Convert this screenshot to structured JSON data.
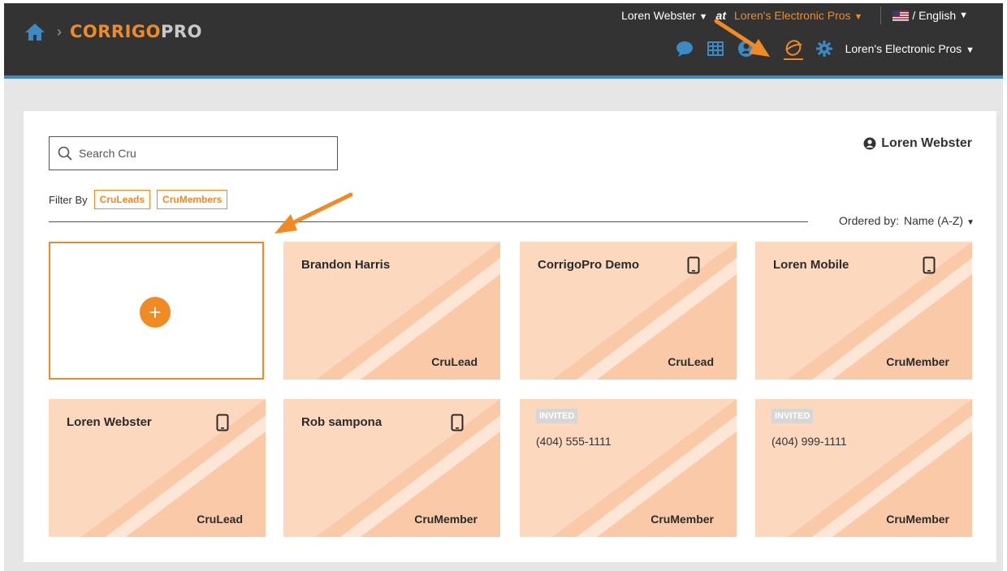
{
  "header": {
    "logo_part1": "CORRIGO",
    "logo_part2": "PRO",
    "crumb_sep": "›",
    "user_name": "Loren Webster",
    "at_label": "at",
    "org_name": "Loren's Electronic Pros",
    "language": "/ English",
    "org_select": "Loren's Electronic Pros",
    "caret": "▼"
  },
  "toolbar_icons": [
    "chat-icon",
    "table-icon",
    "profile-icon",
    "cru-icon",
    "settings-icon"
  ],
  "search": {
    "placeholder": "Search Cru"
  },
  "current_user": "Loren Webster",
  "filter": {
    "label": "Filter By",
    "chips": [
      "CruLeads",
      "CruMembers"
    ]
  },
  "order": {
    "label": "Ordered by:",
    "value": "Name (A-Z)"
  },
  "add_card": {
    "symbol": "+"
  },
  "cards": [
    {
      "name": "Brandon Harris",
      "role": "CruLead",
      "mobile": false
    },
    {
      "name": "CorrigoPro Demo",
      "role": "CruLead",
      "mobile": true
    },
    {
      "name": "Loren Mobile",
      "role": "CruMember",
      "mobile": true
    },
    {
      "name": "Loren Webster",
      "role": "CruLead",
      "mobile": true
    },
    {
      "name": "Rob sampona",
      "role": "CruMember",
      "mobile": true
    },
    {
      "badge": "INVITED",
      "phone": "(404) 555-1111",
      "role": "CruMember"
    },
    {
      "badge": "INVITED",
      "phone": "(404) 999-1111",
      "role": "CruMember"
    }
  ],
  "colors": {
    "accent": "#f08a24",
    "header_bg": "#333333",
    "header_rule": "#3b8ac4",
    "card_bg": "#fcd8bf",
    "toolbar_icon": "#3b8ac4"
  }
}
